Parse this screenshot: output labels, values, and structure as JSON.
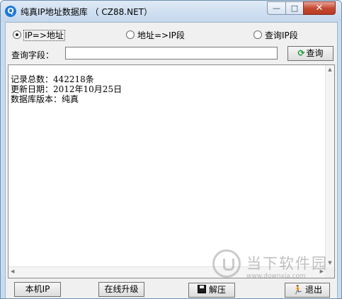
{
  "window": {
    "title": "纯真IP地址数据库 （ CZ88.NET）",
    "icon": "app-logo-icon",
    "controls": {
      "minimize": "—",
      "maximize": "□",
      "close": "✕"
    }
  },
  "mode_options": [
    {
      "label": "IP=>地址",
      "selected": true
    },
    {
      "label": "地址=>IP段",
      "selected": false
    },
    {
      "label": "查询IP段",
      "selected": false
    }
  ],
  "query": {
    "label": "查询字段：",
    "value": "",
    "button_label": "查询",
    "button_icon": "refresh-icon"
  },
  "result": {
    "lines": [
      "记录总数：442218条",
      "更新日期：2012年10月25日",
      "数据库版本：纯真"
    ]
  },
  "buttons": {
    "local_ip": "本机IP",
    "online_upgrade": "在线升级",
    "extract": "解压",
    "extract_icon": "floppy-disk-icon",
    "exit": "退出",
    "exit_icon": "running-man-icon"
  },
  "watermark": {
    "text": "当下软件园",
    "url": "www.downxia.com"
  }
}
